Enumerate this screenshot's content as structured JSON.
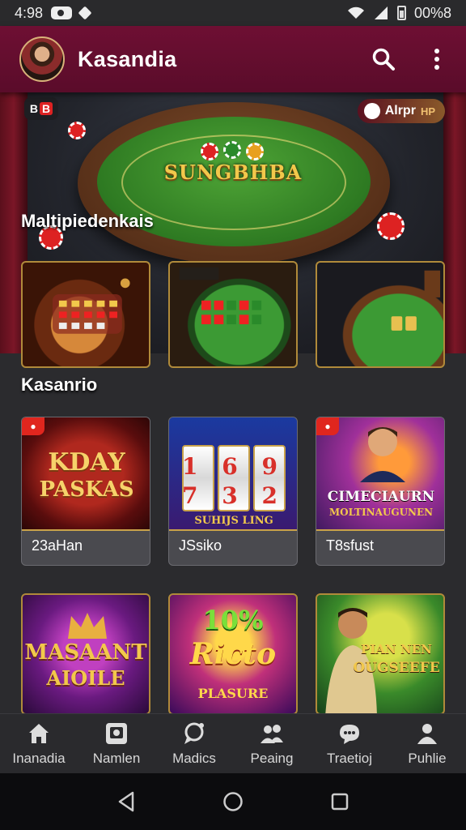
{
  "status_bar": {
    "time": "4:98",
    "battery_text": "00%8"
  },
  "app_bar": {
    "title": "Kasandia",
    "icons": [
      "avatar",
      "search-icon",
      "more-vert-icon"
    ]
  },
  "hero": {
    "game_title": "SUNGBHBA",
    "badge_left_text": "B",
    "badge_left_red": "B",
    "pill_text": "Alrpr",
    "pill_extra": "HP"
  },
  "sections": {
    "multiplayer_title": "Maltipiedenkais",
    "casino_title": "Kasanrio"
  },
  "casino_cards": [
    {
      "label": "23aHan",
      "art_line1": "KDAY",
      "art_line2": "PASKAS"
    },
    {
      "label": "JSsiko",
      "art_line1": "1 6 9",
      "art_line2": "7 3 2",
      "art_footer": "SUHIJS LING"
    },
    {
      "label": "T8sfust",
      "art_line1": "CIMECIAURN",
      "art_line2": "MOLTINAUGUNEN"
    }
  ],
  "promo_cards": [
    {
      "art_line1": "MASAANT",
      "art_line2": "AIOILE"
    },
    {
      "art_line1": "10%",
      "art_line2": "Ricto",
      "art_line3": "PLASURE"
    },
    {
      "art_line1": "PIAN NEN",
      "art_line2": "OUGSEEFE"
    }
  ],
  "bottom_nav": [
    {
      "label": "Inanadia",
      "icon": "home-icon"
    },
    {
      "label": "Namlen",
      "icon": "card-icon"
    },
    {
      "label": "Madics",
      "icon": "chat-bubble-icon"
    },
    {
      "label": "Peaing",
      "icon": "group-icon"
    },
    {
      "label": "Traetioj",
      "icon": "message-icon"
    },
    {
      "label": "Puhlie",
      "icon": "profile-icon"
    }
  ],
  "colors": {
    "appbar": "#6e0f33",
    "accent_gold": "#c9a24a",
    "background": "#2b2b2e"
  }
}
